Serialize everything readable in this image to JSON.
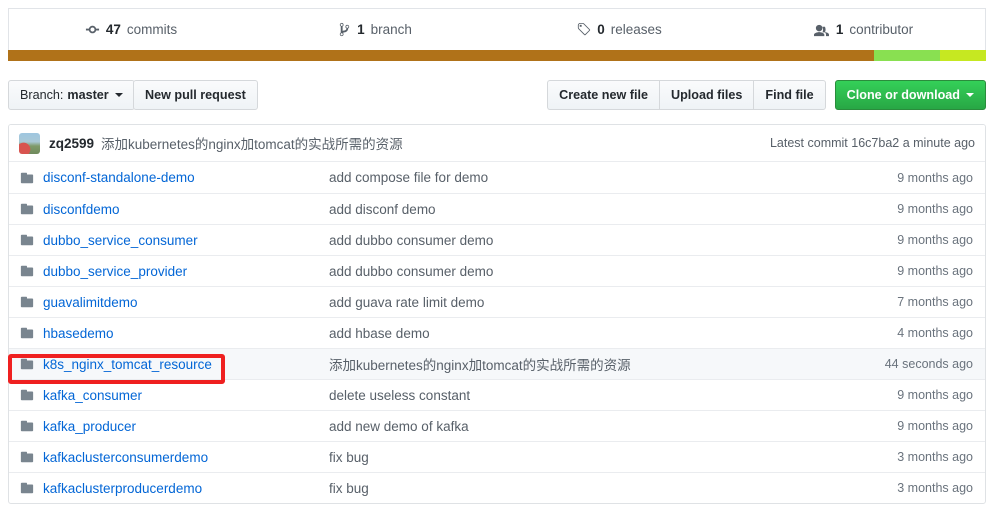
{
  "stats": [
    {
      "icon": "commit-icon",
      "count": "47",
      "label": "commits"
    },
    {
      "icon": "branch-icon",
      "count": "1",
      "label": "branch"
    },
    {
      "icon": "tag-icon",
      "count": "0",
      "label": "releases"
    },
    {
      "icon": "people-icon",
      "count": "1",
      "label": "contributor"
    }
  ],
  "language_bar": [
    {
      "name": "Java",
      "color": "#b07219",
      "percent": 88.5
    },
    {
      "name": "Shell",
      "color": "#89e051",
      "percent": 6.8
    },
    {
      "name": "JavaScript",
      "color": "#c6e821",
      "percent": 4.7
    }
  ],
  "toolbar": {
    "branch_prefix": "Branch:",
    "branch_name": "master",
    "new_pull_request": "New pull request",
    "create_new_file": "Create new file",
    "upload_files": "Upload files",
    "find_file": "Find file",
    "clone_or_download": "Clone or download",
    "clone_color": "#28a745"
  },
  "commit_header": {
    "author": "zq2599",
    "message": "添加kubernetes的nginx加tomcat的实战所需的资源",
    "latest_commit_label": "Latest commit",
    "sha": "16c7ba2",
    "time": "a minute ago"
  },
  "files": [
    {
      "icon": "folder-icon",
      "name": "disconf-standalone-demo",
      "message": "add compose file for demo",
      "time": "9 months ago",
      "highlighted": false
    },
    {
      "icon": "folder-icon",
      "name": "disconfdemo",
      "message": "add disconf demo",
      "time": "9 months ago",
      "highlighted": false
    },
    {
      "icon": "folder-icon",
      "name": "dubbo_service_consumer",
      "message": "add dubbo consumer demo",
      "time": "9 months ago",
      "highlighted": false
    },
    {
      "icon": "folder-icon",
      "name": "dubbo_service_provider",
      "message": "add dubbo consumer demo",
      "time": "9 months ago",
      "highlighted": false
    },
    {
      "icon": "folder-icon",
      "name": "guavalimitdemo",
      "message": "add guava rate limit demo",
      "time": "7 months ago",
      "highlighted": false
    },
    {
      "icon": "folder-icon",
      "name": "hbasedemo",
      "message": "add hbase demo",
      "time": "4 months ago",
      "highlighted": false
    },
    {
      "icon": "folder-icon",
      "name": "k8s_nginx_tomcat_resource",
      "message": "添加kubernetes的nginx加tomcat的实战所需的资源",
      "time": "44 seconds ago",
      "highlighted": true
    },
    {
      "icon": "folder-icon",
      "name": "kafka_consumer",
      "message": "delete useless constant",
      "time": "9 months ago",
      "highlighted": false
    },
    {
      "icon": "folder-icon",
      "name": "kafka_producer",
      "message": "add new demo of kafka",
      "time": "9 months ago",
      "highlighted": false
    },
    {
      "icon": "folder-icon",
      "name": "kafkaclusterconsumerdemo",
      "message": "fix bug",
      "time": "3 months ago",
      "highlighted": false
    },
    {
      "icon": "folder-icon",
      "name": "kafkaclusterproducerdemo",
      "message": "fix bug",
      "time": "3 months ago",
      "highlighted": false
    }
  ],
  "annotation": {
    "shape": "rectangle",
    "color": "#ef2020",
    "targets": "k8s_nginx_tomcat_resource"
  }
}
